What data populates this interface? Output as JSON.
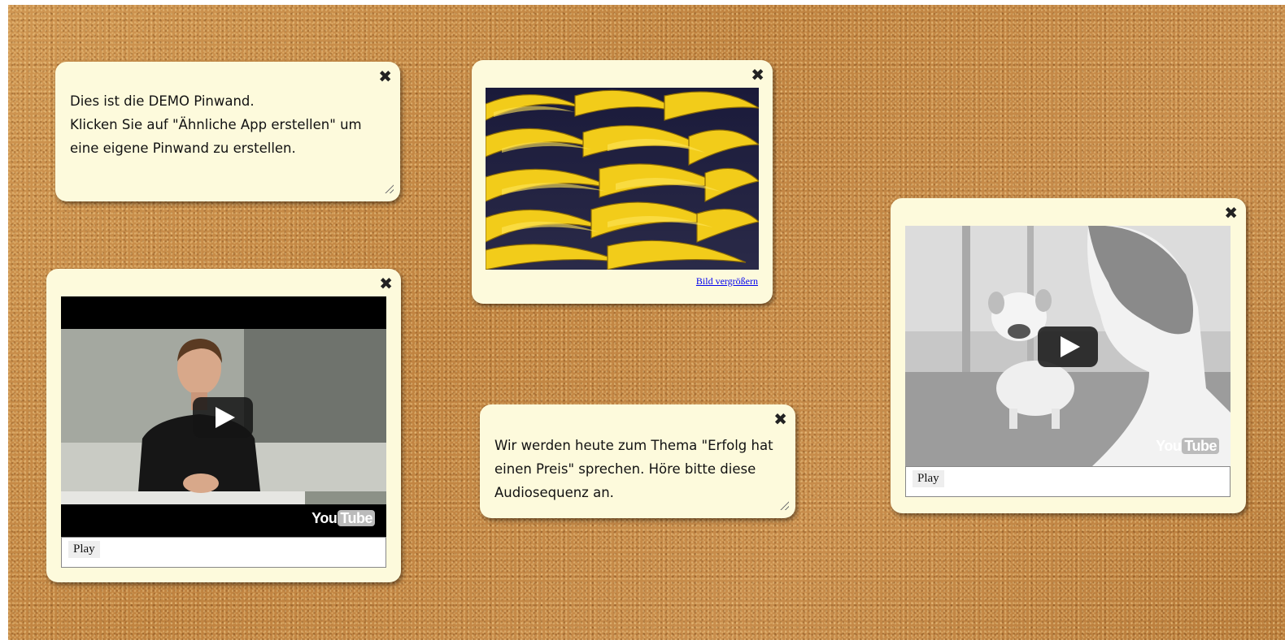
{
  "board": {
    "notes": [
      {
        "text": "Dies ist die DEMO Pinwand.\nKlicken Sie auf \"Ähnliche App erstellen\" um eine eigene Pinwand zu erstellen.",
        "close_icon": "✖"
      },
      {
        "text": "Wir werden heute zum Thema \"Erfolg hat einen Preis\" sprechen. Höre bitte diese Audiosequenz an.",
        "close_icon": "✖"
      }
    ],
    "image_card": {
      "close_icon": "✖",
      "image": "bananas-photo",
      "link_label": "Bild vergrößern"
    },
    "video_cards": [
      {
        "close_icon": "✖",
        "thumbnail": "man-in-suit-video",
        "logo_you": "You",
        "logo_tube": "Tube",
        "play_label": "Play"
      },
      {
        "close_icon": "✖",
        "thumbnail": "bulldog-puppy-video",
        "logo_you": "You",
        "logo_tube": "Tube",
        "play_label": "Play"
      }
    ]
  },
  "colors": {
    "cork": "#c48a48",
    "note": "#fdfadc",
    "link": "#0000ee"
  }
}
